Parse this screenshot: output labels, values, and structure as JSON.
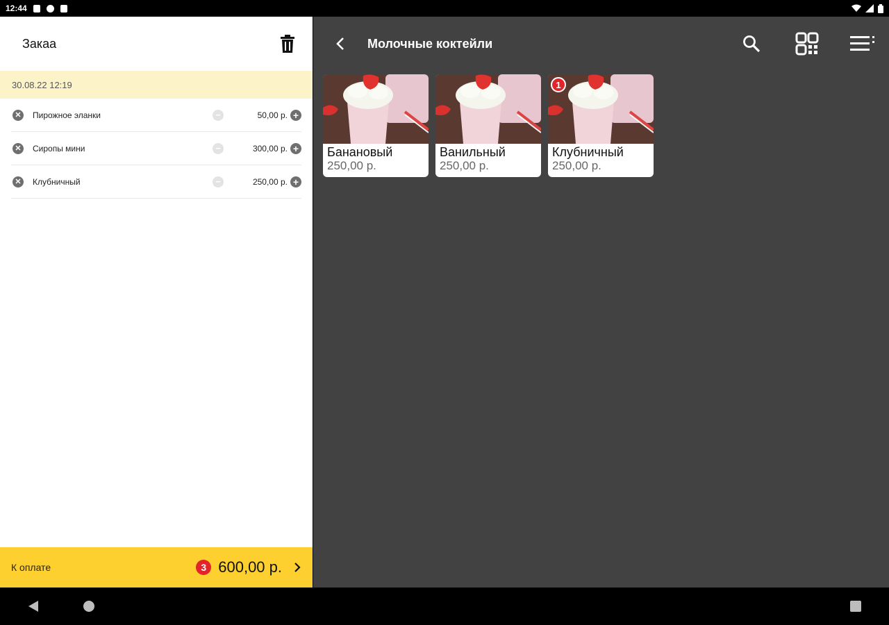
{
  "status": {
    "time": "12:44"
  },
  "order": {
    "title": "Закаа",
    "date": "30.08.22 12:19",
    "items": [
      {
        "name": "Пирожное эланки",
        "price": "50,00 р."
      },
      {
        "name": "Сиропы мини",
        "price": "300,00 р."
      },
      {
        "name": "Клубничный",
        "price": "250,00 р."
      }
    ],
    "pay_label": "К оплате",
    "count": "3",
    "total": "600,00 р."
  },
  "catalog": {
    "title": "Молочные коктейли",
    "products": [
      {
        "name": "Банановый",
        "price": "250,00 р.",
        "badge": ""
      },
      {
        "name": "Ванильный",
        "price": "250,00 р.",
        "badge": ""
      },
      {
        "name": "Клубничный",
        "price": "250,00 р.",
        "badge": "1"
      }
    ]
  },
  "icons": {
    "trash": "trash-icon",
    "back": "chevron-left-icon",
    "search": "search-icon",
    "qr": "qr-code-icon",
    "menu": "menu-icon",
    "proceed": "chevron-right-icon"
  },
  "colors": {
    "pay_bar": "#fdd02f",
    "date_bar": "#fdf3c9",
    "catalog_bg": "#424242",
    "badge": "#e3242b"
  }
}
